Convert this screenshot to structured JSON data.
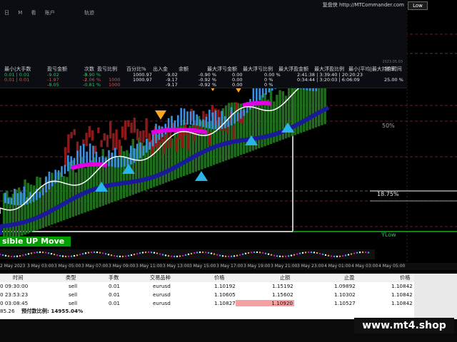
{
  "panel": {
    "tabs": [
      "日",
      "M",
      "看",
      "账户"
    ],
    "center_tab": "轨迹",
    "brand": "复盘侠 http://MTCommander.com",
    "date": "2023.05.03",
    "headers": [
      "最小|大手数",
      "盈亏金额",
      "次数",
      "盈亏比例",
      "百分比%",
      "出入金",
      "余额",
      "最大浮亏金额",
      "最大浮亏比例",
      "最大浮盈金额",
      "最大浮盈比例",
      "最小|平均|最大持仓时间",
      "胜率"
    ],
    "rows": [
      {
        "lot": "0.01 | 0.01",
        "pnl": "-9.02",
        "count": "3",
        "pct": "-0.90 %",
        "deposit": "",
        "balance": "1000.97",
        "maxloss": "-9.02",
        "maxlosspct": "-0.90 %",
        "maxprofit": "0.00",
        "maxprofitpct": "0.00 %",
        "time": "2:41:38 | 3:39:40 | 20:20:23",
        "win": ""
      },
      {
        "lot": "0.01 | 0.01",
        "pnl": "-1.97",
        "count": "2",
        "pct": "-1.06 %",
        "deposit": "1000",
        "balance": "1000.97",
        "maxloss": "-9.17",
        "maxlosspct": "-0.92 %",
        "maxprofit": "0.00",
        "maxprofitpct": "0 %",
        "time": "0:34:44 | 3:20:03 | 6:06:09",
        "win": "25.00 %"
      },
      {
        "lot": "",
        "pnl": "-8.05",
        "count": "",
        "pct": "-0.81 %",
        "deposit": "1000",
        "balance": "",
        "maxloss": "-9.17",
        "maxlosspct": "-0.92 %",
        "maxprofit": "0.00",
        "maxprofitpct": "0 %",
        "time": "",
        "win": ""
      }
    ]
  },
  "chart": {
    "move_label": "sible UP Move",
    "pct50": "50%",
    "pct1875": "18.75%",
    "ylow": "YLow",
    "high_button": "Low",
    "time_labels": [
      "2 May 2023",
      "3 May 03:00",
      "3 May 05:00",
      "3 May 07:00",
      "3 May 09:00",
      "3 May 11:00",
      "3 May 13:00",
      "3 May 15:00",
      "3 May 17:00",
      "3 May 19:00",
      "3 May 21:00",
      "3 May 23:00",
      "4 May 01:00",
      "4 May 03:00",
      "4 May 05:00"
    ]
  },
  "table": {
    "headers": [
      "时间",
      "类型",
      "手数",
      "交易品种",
      "价格",
      "止损",
      "止盈",
      "价格"
    ],
    "rows": [
      {
        "time": "0 09:30:00",
        "type": "sell",
        "lot": "0.01",
        "symbol": "eurusd",
        "price": "1.10192",
        "sl": "1.15192",
        "tp": "1.09892",
        "cur": "1.10842",
        "hl": false
      },
      {
        "time": "0 23:53:23",
        "type": "sell",
        "lot": "0.01",
        "symbol": "eurusd",
        "price": "1.10605",
        "sl": "1.15602",
        "tp": "1.10302",
        "cur": "1.10842",
        "hl": false
      },
      {
        "time": "0 03:08:45",
        "type": "sell",
        "lot": "0.01",
        "symbol": "eurusd",
        "price": "1.10827",
        "sl": "1.10920",
        "tp": "1.10527",
        "cur": "1.10842",
        "hl": true
      }
    ],
    "footer_left": "85.26",
    "footer_label": "预付款比例: 14955.04%"
  },
  "watermark": "www.mt4.shop",
  "colors": {
    "bull": "#3b8fe0",
    "bear": "#8b1a1a",
    "histo": "#1f6f1f",
    "ma": "#1a1a99",
    "magenta": "#e000e0",
    "cyan": "#29b5e8",
    "axis": "#b8bcc4"
  }
}
